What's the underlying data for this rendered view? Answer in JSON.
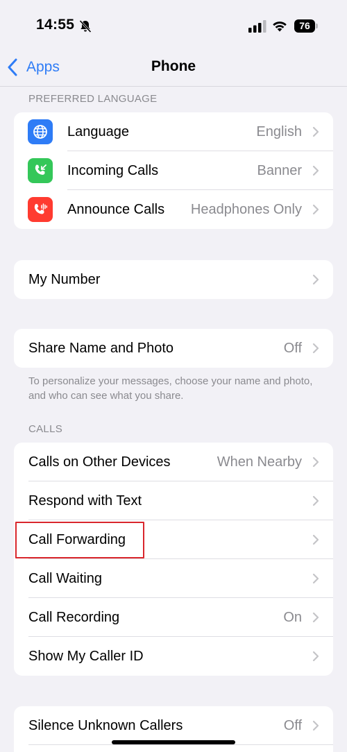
{
  "status": {
    "time": "14:55",
    "battery": "76"
  },
  "nav": {
    "back_label": "Apps",
    "title": "Phone"
  },
  "preferred_language": {
    "header": "PREFERRED LANGUAGE",
    "items": [
      {
        "label": "Language",
        "value": "English",
        "icon": "globe-icon",
        "color": "#2e7cf6"
      },
      {
        "label": "Incoming Calls",
        "value": "Banner",
        "icon": "incoming-call-icon",
        "color": "#34c759"
      },
      {
        "label": "Announce Calls",
        "value": "Headphones Only",
        "icon": "announce-call-icon",
        "color": "#ff3b30"
      }
    ]
  },
  "my_number": {
    "label": "My Number"
  },
  "share": {
    "label": "Share Name and Photo",
    "value": "Off",
    "footer": "To personalize your messages, choose your name and photo, and who can see what you share."
  },
  "calls": {
    "header": "CALLS",
    "items": [
      {
        "label": "Calls on Other Devices",
        "value": "When Nearby"
      },
      {
        "label": "Respond with Text",
        "value": ""
      },
      {
        "label": "Call Forwarding",
        "value": ""
      },
      {
        "label": "Call Waiting",
        "value": ""
      },
      {
        "label": "Call Recording",
        "value": "On"
      },
      {
        "label": "Show My Caller ID",
        "value": ""
      }
    ]
  },
  "silence": {
    "label": "Silence Unknown Callers",
    "value": "Off"
  }
}
